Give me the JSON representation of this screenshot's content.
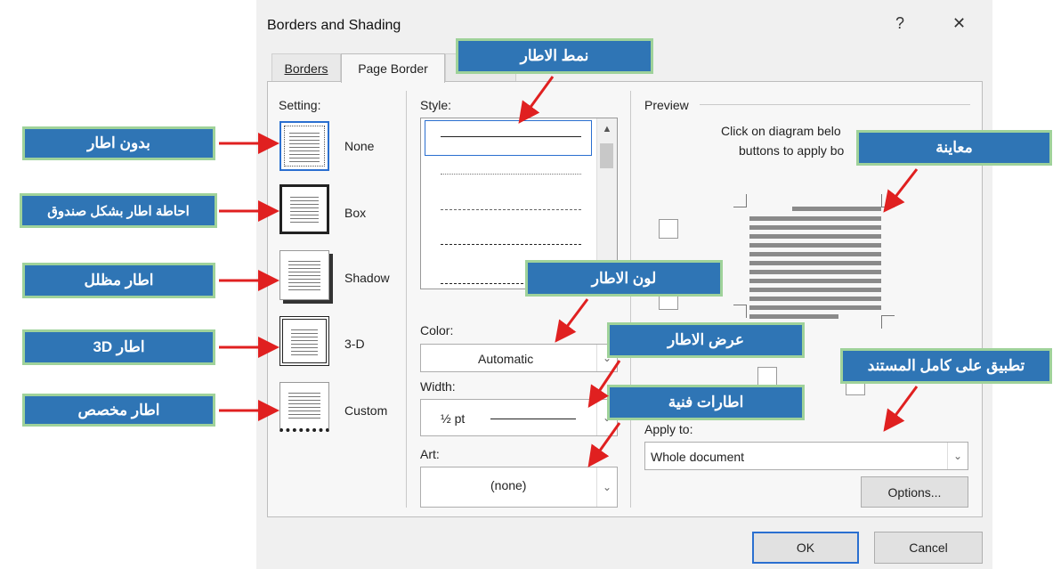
{
  "dialog": {
    "title": "Borders and Shading",
    "help_icon": "?",
    "close_icon": "✕",
    "tabs": [
      {
        "label": "Borders"
      },
      {
        "label": "Page Border"
      }
    ],
    "setting": {
      "label": "Setting:",
      "items": [
        {
          "label": "None"
        },
        {
          "label": "Box"
        },
        {
          "label": "Shadow"
        },
        {
          "label": "3-D"
        },
        {
          "label": "Custom"
        }
      ]
    },
    "style": {
      "label": "Style:"
    },
    "color": {
      "label": "Color:",
      "value": "Automatic"
    },
    "width": {
      "label": "Width:",
      "value": "½ pt"
    },
    "art": {
      "label": "Art:",
      "value": "(none)"
    },
    "preview": {
      "label": "Preview",
      "instruction_line1": "Click on diagram belo",
      "instruction_line2": "buttons to apply bo"
    },
    "apply_to": {
      "label": "Apply to:",
      "value": "Whole document"
    },
    "options_button": "Options...",
    "ok_button": "OK",
    "cancel_button": "Cancel"
  },
  "callouts": {
    "no_border": "بدون اطار",
    "box_border": "احاطة اطار بشكل صندوق",
    "shadow_border": "اطار مظلل",
    "border_3d": "اطار 3D",
    "custom_border": "اطار مخصص",
    "border_style": "نمط الاطار",
    "border_color": "لون الاطار",
    "border_width": "عرض الاطار",
    "art_borders": "اطارات فنية",
    "preview": "معاينة",
    "apply_whole_doc": "تطبيق على كامل المستند"
  },
  "colors": {
    "callout_bg": "#2f75b5",
    "callout_border": "#9fd29a",
    "arrow": "#e02020",
    "accent": "#2a6fd0"
  }
}
